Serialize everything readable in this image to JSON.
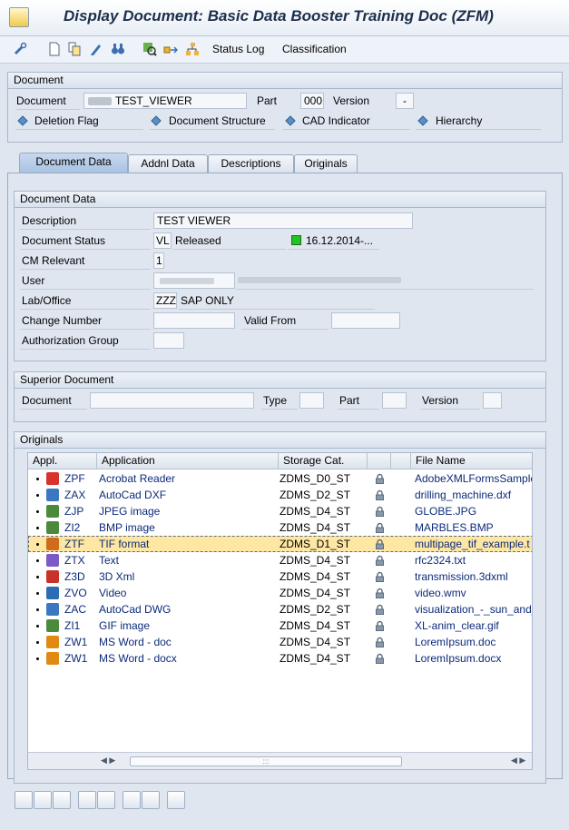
{
  "window": {
    "title": "Display Document: Basic Data Booster Training Doc (ZFM)"
  },
  "toolbar": {
    "status_log": "Status Log",
    "classification": "Classification"
  },
  "header_group": {
    "title": "Document",
    "document_label": "Document",
    "document_value": "TEST_VIEWER",
    "part_label": "Part",
    "part_value": "000",
    "version_label": "Version",
    "version_value": "-",
    "deletion_flag": "Deletion Flag",
    "document_structure": "Document Structure",
    "cad_indicator": "CAD Indicator",
    "hierarchy": "Hierarchy"
  },
  "tabs": [
    {
      "label": "Document Data"
    },
    {
      "label": "Addnl Data"
    },
    {
      "label": "Descriptions"
    },
    {
      "label": "Originals"
    }
  ],
  "document_data": {
    "title": "Document Data",
    "description_label": "Description",
    "description_value": "TEST VIEWER",
    "status_label": "Document Status",
    "status_code": "VL",
    "status_text": "Released",
    "status_date": "16.12.2014-...",
    "status_color": "#22c322",
    "cm_label": "CM Relevant",
    "cm_value": "1",
    "user_label": "User",
    "lab_label": "Lab/Office",
    "lab_code": "ZZZ",
    "lab_text": "SAP ONLY",
    "change_label": "Change Number",
    "valid_label": "Valid From",
    "auth_label": "Authorization Group"
  },
  "superior": {
    "title": "Superior Document",
    "document_label": "Document",
    "type_label": "Type",
    "part_label": "Part",
    "version_label": "Version"
  },
  "originals": {
    "title": "Originals",
    "columns": [
      "Appl.",
      "Application",
      "Storage Cat.",
      "",
      "File Name"
    ],
    "rows": [
      {
        "appl": "ZPF",
        "application": "Acrobat Reader",
        "storage": "ZDMS_D0_ST",
        "file": "AdobeXMLFormsSample.",
        "icon": "pdf-icon",
        "color": "#d8322a"
      },
      {
        "appl": "ZAX",
        "application": "AutoCad DXF",
        "storage": "ZDMS_D2_ST",
        "file": "drilling_machine.dxf",
        "icon": "autocad-icon",
        "color": "#3a78c2"
      },
      {
        "appl": "ZJP",
        "application": "JPEG image",
        "storage": "ZDMS_D4_ST",
        "file": "GLOBE.JPG",
        "icon": "image-icon",
        "color": "#4b8a3b"
      },
      {
        "appl": "ZI2",
        "application": "BMP image",
        "storage": "ZDMS_D4_ST",
        "file": "MARBLES.BMP",
        "icon": "image-icon",
        "color": "#4b8a3b"
      },
      {
        "appl": "ZTF",
        "application": "TIF format",
        "storage": "ZDMS_D1_ST",
        "file": "multipage_tif_example.t",
        "icon": "tif-icon",
        "color": "#cf6b1a"
      },
      {
        "appl": "ZTX",
        "application": "Text",
        "storage": "ZDMS_D4_ST",
        "file": "rfc2324.txt",
        "icon": "text-icon",
        "color": "#7a5ac4"
      },
      {
        "appl": "Z3D",
        "application": "3D Xml",
        "storage": "ZDMS_D4_ST",
        "file": "transmission.3dxml",
        "icon": "3d-icon",
        "color": "#c8322a"
      },
      {
        "appl": "ZVO",
        "application": "Video",
        "storage": "ZDMS_D4_ST",
        "file": "video.wmv",
        "icon": "video-icon",
        "color": "#2b6db3"
      },
      {
        "appl": "ZAC",
        "application": "AutoCad DWG",
        "storage": "ZDMS_D2_ST",
        "file": "visualization_-_sun_and_",
        "icon": "autocad-icon",
        "color": "#3a78c2"
      },
      {
        "appl": "ZI1",
        "application": "GIF image",
        "storage": "ZDMS_D4_ST",
        "file": "XL-anim_clear.gif",
        "icon": "image-icon",
        "color": "#4b8a3b"
      },
      {
        "appl": "ZW1",
        "application": "MS Word - doc",
        "storage": "ZDMS_D4_ST",
        "file": "LoremIpsum.doc",
        "icon": "word-icon",
        "color": "#e08a12"
      },
      {
        "appl": "ZW1",
        "application": "MS Word - docx",
        "storage": "ZDMS_D4_ST",
        "file": "LoremIpsum.docx",
        "icon": "word-icon",
        "color": "#e08a12"
      }
    ],
    "scroll_mid": ":::"
  }
}
